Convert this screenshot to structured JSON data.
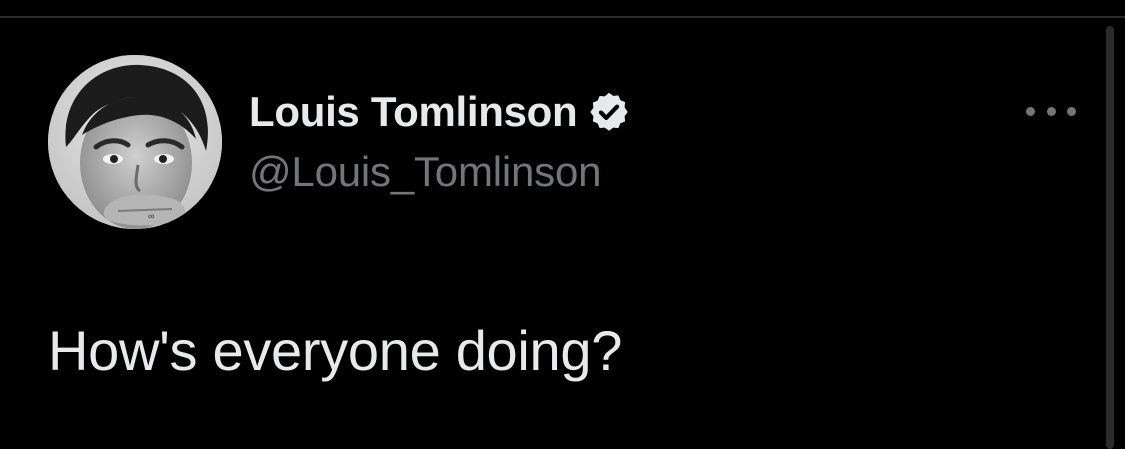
{
  "tweet": {
    "author": {
      "display_name": "Louis Tomlinson",
      "handle": "@Louis_Tomlinson",
      "verified": true,
      "avatar_icon": "profile-photo-grayscale"
    },
    "text": "How's everyone doing?",
    "more_icon": "more-options-icon"
  },
  "colors": {
    "background": "#000000",
    "primary_text": "#e7e9ea",
    "secondary_text": "#71767b",
    "divider": "#2a2a2a"
  }
}
